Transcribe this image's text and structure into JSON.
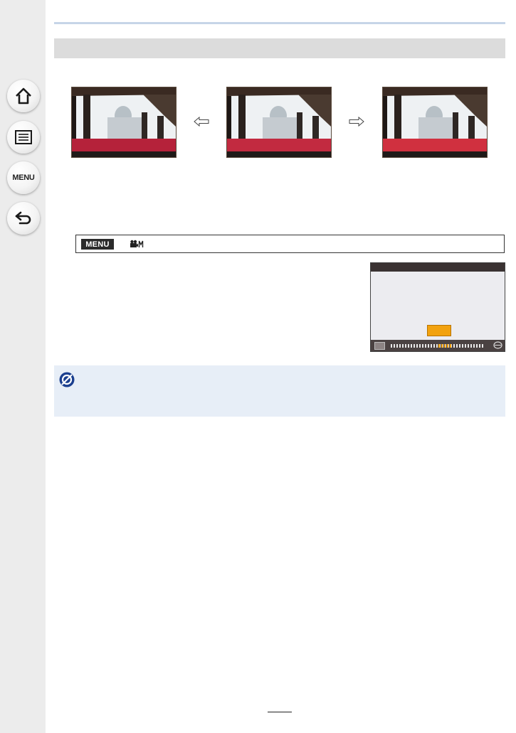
{
  "sidebar": {
    "items": [
      {
        "name": "home",
        "icon": "home-icon"
      },
      {
        "name": "contents",
        "icon": "list-icon"
      },
      {
        "name": "menu",
        "icon": "menu-label",
        "label": "MENU"
      },
      {
        "name": "back",
        "icon": "return-arrow-icon"
      }
    ]
  },
  "menu_path": {
    "menu_label": "MENU",
    "mode_icon": "motion-picture-manual-icon"
  },
  "comparison": {
    "arrows": [
      "left-outline-arrow-icon",
      "right-outline-arrow-icon"
    ],
    "images": 3
  },
  "note": {
    "icon": "prohibition-icon"
  },
  "colors": {
    "sidebar_bg": "#ececec",
    "rule": "#c6d5e8",
    "section_bar": "#dcdcdc",
    "note_bg": "#e7eef7",
    "highlight": "#f2a20f"
  }
}
